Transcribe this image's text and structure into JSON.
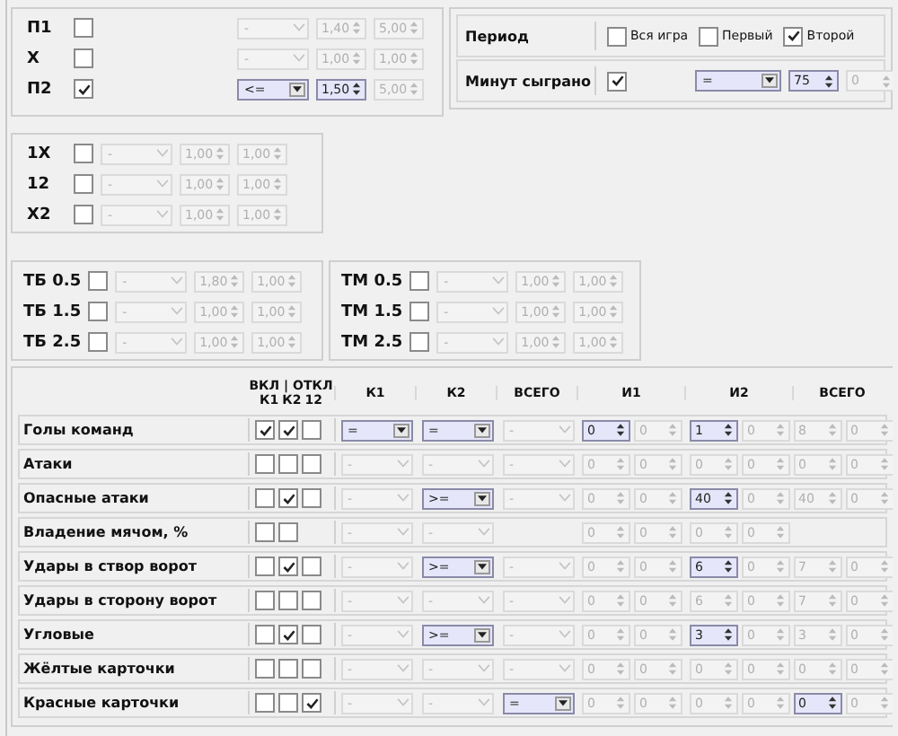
{
  "odds_group_1": {
    "rows": [
      {
        "label": "П1",
        "checked": false,
        "combo": {
          "value": "-",
          "enabled": false
        },
        "spins": [
          {
            "value": "1,40",
            "enabled": false
          },
          {
            "value": "5,00",
            "enabled": false
          }
        ]
      },
      {
        "label": "Х",
        "checked": false,
        "combo": {
          "value": "-",
          "enabled": false
        },
        "spins": [
          {
            "value": "1,00",
            "enabled": false
          },
          {
            "value": "1,00",
            "enabled": false
          }
        ]
      },
      {
        "label": "П2",
        "checked": true,
        "combo": {
          "value": "<=",
          "enabled": true
        },
        "spins": [
          {
            "value": "1,50",
            "enabled": true
          },
          {
            "value": "5,00",
            "enabled": false
          }
        ]
      }
    ]
  },
  "period_panel": {
    "period": {
      "label": "Период",
      "options": [
        {
          "label": "Вся игра",
          "checked": false
        },
        {
          "label": "Первый",
          "checked": false
        },
        {
          "label": "Второй",
          "checked": true
        }
      ]
    },
    "minutes": {
      "label": "Минут сыграно",
      "checked": true,
      "combo": {
        "value": "=",
        "enabled": true
      },
      "spins": [
        {
          "value": "75",
          "enabled": true
        },
        {
          "value": "0",
          "enabled": false
        }
      ]
    }
  },
  "odds_group_2": {
    "rows": [
      {
        "label": "1Х",
        "checked": false,
        "combo": {
          "value": "-",
          "enabled": false
        },
        "spins": [
          {
            "value": "1,00",
            "enabled": false
          },
          {
            "value": "1,00",
            "enabled": false
          }
        ]
      },
      {
        "label": "12",
        "checked": false,
        "combo": {
          "value": "-",
          "enabled": false
        },
        "spins": [
          {
            "value": "1,00",
            "enabled": false
          },
          {
            "value": "1,00",
            "enabled": false
          }
        ]
      },
      {
        "label": "Х2",
        "checked": false,
        "combo": {
          "value": "-",
          "enabled": false
        },
        "spins": [
          {
            "value": "1,00",
            "enabled": false
          },
          {
            "value": "1,00",
            "enabled": false
          }
        ]
      }
    ]
  },
  "totals_over": {
    "rows": [
      {
        "label": "ТБ 0.5",
        "checked": false,
        "combo": {
          "value": "-",
          "enabled": false
        },
        "spins": [
          {
            "value": "1,80",
            "enabled": false
          },
          {
            "value": "1,00",
            "enabled": false
          }
        ]
      },
      {
        "label": "ТБ 1.5",
        "checked": false,
        "combo": {
          "value": "-",
          "enabled": false
        },
        "spins": [
          {
            "value": "1,00",
            "enabled": false
          },
          {
            "value": "1,00",
            "enabled": false
          }
        ]
      },
      {
        "label": "ТБ 2.5",
        "checked": false,
        "combo": {
          "value": "-",
          "enabled": false
        },
        "spins": [
          {
            "value": "1,00",
            "enabled": false
          },
          {
            "value": "1,00",
            "enabled": false
          }
        ]
      }
    ]
  },
  "totals_under": {
    "rows": [
      {
        "label": "ТМ 0.5",
        "checked": false,
        "combo": {
          "value": "-",
          "enabled": false
        },
        "spins": [
          {
            "value": "1,00",
            "enabled": false
          },
          {
            "value": "1,00",
            "enabled": false
          }
        ]
      },
      {
        "label": "ТМ 1.5",
        "checked": false,
        "combo": {
          "value": "-",
          "enabled": false
        },
        "spins": [
          {
            "value": "1,00",
            "enabled": false
          },
          {
            "value": "1,00",
            "enabled": false
          }
        ]
      },
      {
        "label": "ТМ 2.5",
        "checked": false,
        "combo": {
          "value": "-",
          "enabled": false
        },
        "spins": [
          {
            "value": "1,00",
            "enabled": false
          },
          {
            "value": "1,00",
            "enabled": false
          }
        ]
      }
    ]
  },
  "stats_table": {
    "header": {
      "toggle_title": "ВКЛ | ОТКЛ",
      "toggle_columns": [
        "К1",
        "К2",
        "12"
      ],
      "columns": [
        "К1",
        "К2",
        "ВСЕГО",
        "И1",
        "И2",
        "ВСЕГО"
      ]
    },
    "rows": [
      {
        "label": "Голы команд",
        "checks": [
          {
            "checked": true
          },
          {
            "checked": true
          },
          {
            "checked": false
          }
        ],
        "combos": [
          {
            "value": "=",
            "enabled": true
          },
          {
            "value": "=",
            "enabled": true
          },
          {
            "value": "-",
            "enabled": false
          }
        ],
        "spins": [
          {
            "value": "0",
            "enabled": true
          },
          {
            "value": "0",
            "enabled": false
          },
          {
            "value": "1",
            "enabled": true
          },
          {
            "value": "0",
            "enabled": false
          },
          {
            "value": "8",
            "enabled": false
          },
          {
            "value": "0",
            "enabled": false
          }
        ]
      },
      {
        "label": "Атаки",
        "checks": [
          {
            "checked": false
          },
          {
            "checked": false
          },
          {
            "checked": false
          }
        ],
        "combos": [
          {
            "value": "-",
            "enabled": false
          },
          {
            "value": "-",
            "enabled": false
          },
          {
            "value": "-",
            "enabled": false
          }
        ],
        "spins": [
          {
            "value": "0",
            "enabled": false
          },
          {
            "value": "0",
            "enabled": false
          },
          {
            "value": "0",
            "enabled": false
          },
          {
            "value": "0",
            "enabled": false
          },
          {
            "value": "0",
            "enabled": false
          },
          {
            "value": "0",
            "enabled": false
          }
        ]
      },
      {
        "label": "Опасные атаки",
        "checks": [
          {
            "checked": false
          },
          {
            "checked": true
          },
          {
            "checked": false
          }
        ],
        "combos": [
          {
            "value": "-",
            "enabled": false
          },
          {
            "value": ">=",
            "enabled": true
          },
          {
            "value": "-",
            "enabled": false
          }
        ],
        "spins": [
          {
            "value": "0",
            "enabled": false
          },
          {
            "value": "0",
            "enabled": false
          },
          {
            "value": "40",
            "enabled": true
          },
          {
            "value": "0",
            "enabled": false
          },
          {
            "value": "40",
            "enabled": false
          },
          {
            "value": "0",
            "enabled": false
          }
        ]
      },
      {
        "label": "Владение мячом, %",
        "checks": [
          {
            "checked": false
          },
          {
            "checked": false
          }
        ],
        "combos": [
          {
            "value": "-",
            "enabled": false
          },
          {
            "value": "-",
            "enabled": false
          }
        ],
        "spins": [
          {
            "value": "0",
            "enabled": false
          },
          {
            "value": "0",
            "enabled": false
          },
          {
            "value": "0",
            "enabled": false
          },
          {
            "value": "0",
            "enabled": false
          }
        ]
      },
      {
        "label": "Удары в створ ворот",
        "checks": [
          {
            "checked": false
          },
          {
            "checked": true
          },
          {
            "checked": false
          }
        ],
        "combos": [
          {
            "value": "-",
            "enabled": false
          },
          {
            "value": ">=",
            "enabled": true
          },
          {
            "value": "-",
            "enabled": false
          }
        ],
        "spins": [
          {
            "value": "0",
            "enabled": false
          },
          {
            "value": "0",
            "enabled": false
          },
          {
            "value": "6",
            "enabled": true
          },
          {
            "value": "0",
            "enabled": false
          },
          {
            "value": "7",
            "enabled": false
          },
          {
            "value": "0",
            "enabled": false
          }
        ]
      },
      {
        "label": "Удары в сторону ворот",
        "checks": [
          {
            "checked": false
          },
          {
            "checked": false
          },
          {
            "checked": false
          }
        ],
        "combos": [
          {
            "value": "-",
            "enabled": false
          },
          {
            "value": "-",
            "enabled": false
          },
          {
            "value": "-",
            "enabled": false
          }
        ],
        "spins": [
          {
            "value": "0",
            "enabled": false
          },
          {
            "value": "0",
            "enabled": false
          },
          {
            "value": "6",
            "enabled": false
          },
          {
            "value": "0",
            "enabled": false
          },
          {
            "value": "7",
            "enabled": false
          },
          {
            "value": "0",
            "enabled": false
          }
        ]
      },
      {
        "label": "Угловые",
        "checks": [
          {
            "checked": false
          },
          {
            "checked": true
          },
          {
            "checked": false
          }
        ],
        "combos": [
          {
            "value": "-",
            "enabled": false
          },
          {
            "value": ">=",
            "enabled": true
          },
          {
            "value": "-",
            "enabled": false
          }
        ],
        "spins": [
          {
            "value": "0",
            "enabled": false
          },
          {
            "value": "0",
            "enabled": false
          },
          {
            "value": "3",
            "enabled": true
          },
          {
            "value": "0",
            "enabled": false
          },
          {
            "value": "3",
            "enabled": false
          },
          {
            "value": "0",
            "enabled": false
          }
        ]
      },
      {
        "label": "Жёлтые карточки",
        "checks": [
          {
            "checked": false
          },
          {
            "checked": false
          },
          {
            "checked": false
          }
        ],
        "combos": [
          {
            "value": "-",
            "enabled": false
          },
          {
            "value": "-",
            "enabled": false
          },
          {
            "value": "-",
            "enabled": false
          }
        ],
        "spins": [
          {
            "value": "0",
            "enabled": false
          },
          {
            "value": "0",
            "enabled": false
          },
          {
            "value": "0",
            "enabled": false
          },
          {
            "value": "0",
            "enabled": false
          },
          {
            "value": "0",
            "enabled": false
          },
          {
            "value": "0",
            "enabled": false
          }
        ]
      },
      {
        "label": "Красные карточки",
        "checks": [
          {
            "checked": false
          },
          {
            "checked": false
          },
          {
            "checked": true
          }
        ],
        "combos": [
          {
            "value": "-",
            "enabled": false
          },
          {
            "value": "-",
            "enabled": false
          },
          {
            "value": "=",
            "enabled": true
          }
        ],
        "spins": [
          {
            "value": "0",
            "enabled": false
          },
          {
            "value": "0",
            "enabled": false
          },
          {
            "value": "0",
            "enabled": false
          },
          {
            "value": "0",
            "enabled": false
          },
          {
            "value": "0",
            "enabled": true
          },
          {
            "value": "0",
            "enabled": false
          }
        ]
      }
    ]
  }
}
